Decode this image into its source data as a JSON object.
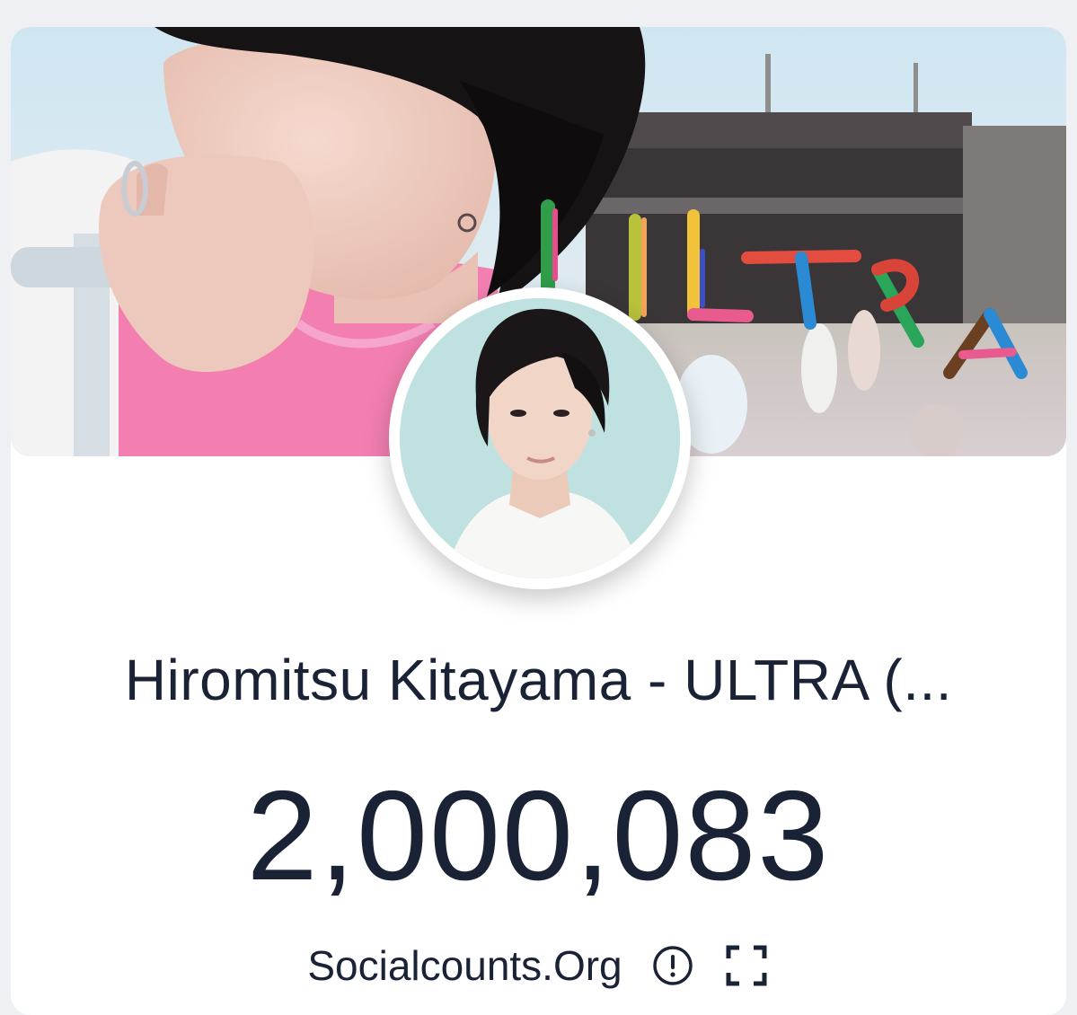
{
  "video": {
    "title": "Hiromitsu Kitayama - ULTRA (...",
    "count": "2,000,083",
    "banner_text": "ULTRA"
  },
  "footer": {
    "brand": "Socialcounts.Org",
    "info_icon": "info-circle-icon",
    "fullscreen_icon": "fullscreen-icon"
  },
  "colors": {
    "text": "#1a2236",
    "card": "#ffffff",
    "page": "#eef0f3",
    "banner_pink": "#f27fb0"
  }
}
